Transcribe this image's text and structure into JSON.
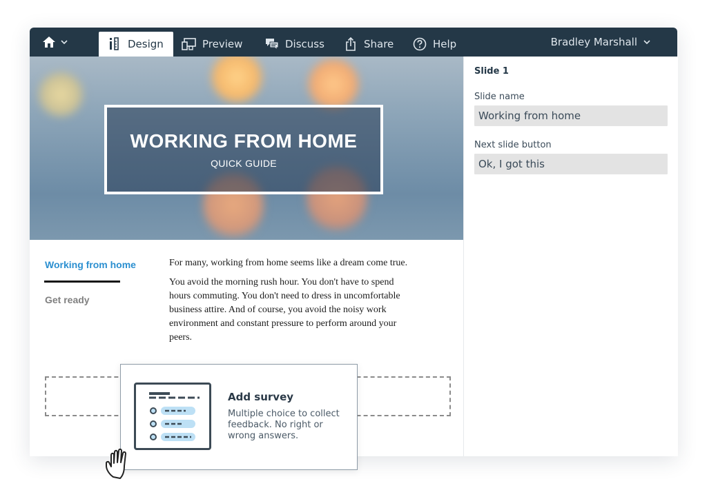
{
  "topbar": {
    "nav": [
      {
        "label": "Design",
        "icon": "design-icon",
        "active": true
      },
      {
        "label": "Preview",
        "icon": "preview-icon"
      },
      {
        "label": "Discuss",
        "icon": "discuss-icon"
      },
      {
        "label": "Share",
        "icon": "share-icon"
      },
      {
        "label": "Help",
        "icon": "help-icon"
      }
    ],
    "user_name": "Bradley Marshall",
    "colors": {
      "bar": "#243847",
      "text": "#dfe6ec"
    }
  },
  "hero": {
    "title": "WORKING FROM HOME",
    "subtitle": "QUICK GUIDE"
  },
  "content": {
    "tabs": [
      {
        "label": "Working from home",
        "active": true
      },
      {
        "label": "Get ready"
      }
    ],
    "paragraphs": [
      "For many, working from home seems like a dream come true.",
      "You avoid the morning rush hour. You don't have to spend hours commuting. You don't need to dress in uncomfortable business attire. And of course, you avoid the noisy work environment and constant pressure to perform around your peers."
    ],
    "accent_color": "#2b8fd0"
  },
  "panel": {
    "slide_title": "Slide 1",
    "slide_name_label": "Slide name",
    "slide_name_value": "Working from home",
    "next_button_label": "Next slide button",
    "next_button_value": "Ok, I got this"
  },
  "survey_card": {
    "title": "Add survey",
    "description": "Multiple choice to collect feedback. No right or wrong answers."
  }
}
